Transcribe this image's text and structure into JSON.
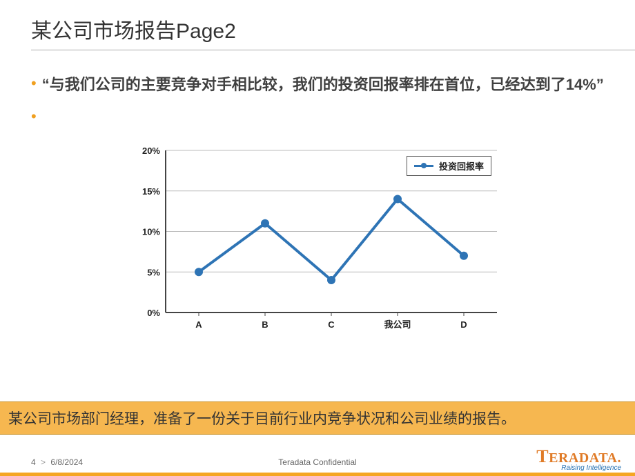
{
  "header": {
    "title": "某公司市场报告Page2"
  },
  "bullets": {
    "item1": "“与我们公司的主要竞争对手相比较，我们的投资回报率排在首位，已经达到了14%”"
  },
  "legend": {
    "label": "投资回报率"
  },
  "caption": "某公司市场部门经理，准备了一份关于目前行业内竞争状况和公司业绩的报告。",
  "footer": {
    "page": "4",
    "caret": ">",
    "date": "6/8/2024",
    "confidential": "Teradata Confidential",
    "logo_main": "TERADATA",
    "logo_sub": "Raising Intelligence"
  },
  "chart_data": {
    "type": "line",
    "title": "",
    "xlabel": "",
    "ylabel": "",
    "ylim": [
      0,
      20
    ],
    "ytick_step": 5,
    "ytick_format": "percent",
    "categories": [
      "A",
      "B",
      "C",
      "我公司",
      "D"
    ],
    "series": [
      {
        "name": "投资回报率",
        "values": [
          5,
          11,
          4,
          14,
          7
        ]
      }
    ]
  }
}
